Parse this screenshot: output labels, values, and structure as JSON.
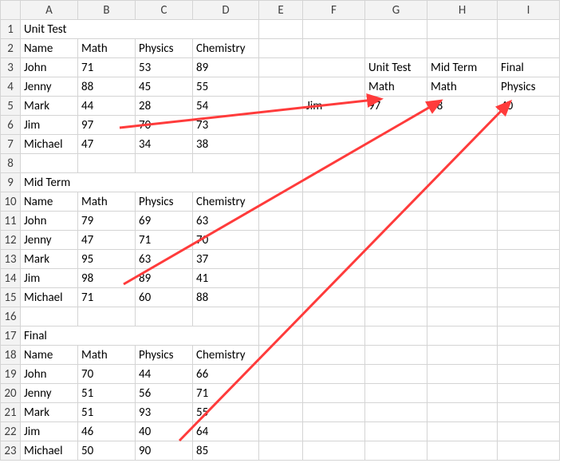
{
  "columns": [
    "A",
    "B",
    "C",
    "D",
    "E",
    "F",
    "G",
    "H",
    "I"
  ],
  "rows": [
    "1",
    "2",
    "3",
    "4",
    "5",
    "6",
    "7",
    "8",
    "9",
    "10",
    "11",
    "12",
    "13",
    "14",
    "15",
    "16",
    "17",
    "18",
    "19",
    "20",
    "21",
    "22",
    "23"
  ],
  "colWidths": {
    "row_hdr": 25,
    "A": 72,
    "B": 72,
    "C": 72,
    "D": 83,
    "E": 55,
    "F": 78,
    "G": 78,
    "H": 88,
    "I": 78
  },
  "tables": {
    "unitTest": {
      "title": "Unit Test",
      "headers": [
        "Name",
        "Math",
        "Physics",
        "Chemistry"
      ],
      "rows": [
        {
          "name": "John",
          "math": 71,
          "physics": 53,
          "chemistry": 89
        },
        {
          "name": "Jenny",
          "math": 88,
          "physics": 45,
          "chemistry": 55
        },
        {
          "name": "Mark",
          "math": 44,
          "physics": 28,
          "chemistry": 54
        },
        {
          "name": "Jim",
          "math": 97,
          "physics": 70,
          "chemistry": 73
        },
        {
          "name": "Michael",
          "math": 47,
          "physics": 34,
          "chemistry": 38
        }
      ]
    },
    "midTerm": {
      "title": "Mid Term",
      "headers": [
        "Name",
        "Math",
        "Physics",
        "Chemistry"
      ],
      "rows": [
        {
          "name": "John",
          "math": 79,
          "physics": 69,
          "chemistry": 63
        },
        {
          "name": "Jenny",
          "math": 47,
          "physics": 71,
          "chemistry": 70
        },
        {
          "name": "Mark",
          "math": 95,
          "physics": 63,
          "chemistry": 37
        },
        {
          "name": "Jim",
          "math": 98,
          "physics": 89,
          "chemistry": 41
        },
        {
          "name": "Michael",
          "math": 71,
          "physics": 60,
          "chemistry": 88
        }
      ]
    },
    "final": {
      "title": "Final",
      "headers": [
        "Name",
        "Math",
        "Physics",
        "Chemistry"
      ],
      "rows": [
        {
          "name": "John",
          "math": 70,
          "physics": 44,
          "chemistry": 66
        },
        {
          "name": "Jenny",
          "math": 51,
          "physics": 56,
          "chemistry": 71
        },
        {
          "name": "Mark",
          "math": 51,
          "physics": 93,
          "chemistry": 55
        },
        {
          "name": "Jim",
          "math": 46,
          "physics": 40,
          "chemistry": 64
        },
        {
          "name": "Michael",
          "math": 50,
          "physics": 90,
          "chemistry": 85
        }
      ]
    }
  },
  "lookup": {
    "headerTop": [
      "Unit Test",
      "Mid Term",
      "Final"
    ],
    "headerBot": [
      "Math",
      "Math",
      "Physics"
    ],
    "key": "Jim",
    "values": [
      97,
      98,
      40
    ]
  },
  "colors": {
    "title_bg": "#fce4d6",
    "header_bg": "#ddebf7",
    "arrow": "#ff3b3b",
    "grid": "#d4d4d4"
  }
}
